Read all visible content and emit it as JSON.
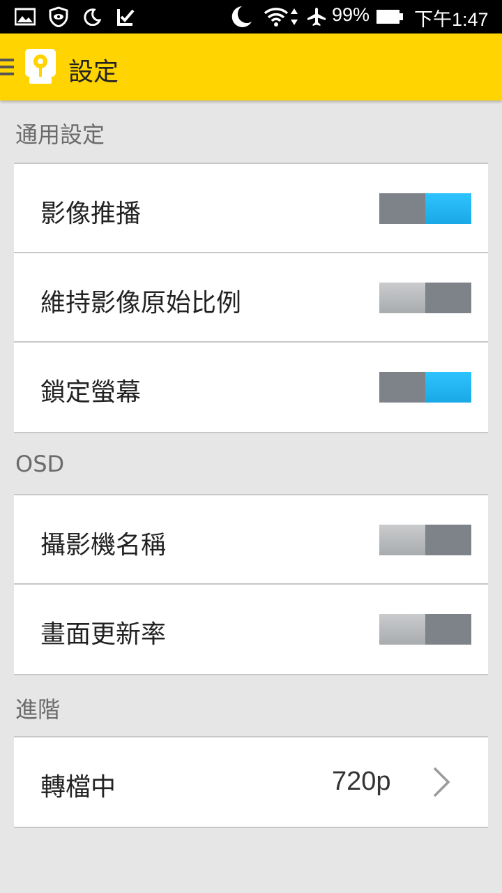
{
  "status_bar": {
    "battery": "99%",
    "time": "下午1:47"
  },
  "app_bar": {
    "title": "設定"
  },
  "sections": [
    {
      "header": "通用設定",
      "items": [
        {
          "label": "影像推播",
          "toggle": true
        },
        {
          "label": "維持影像原始比例",
          "toggle": false
        },
        {
          "label": "鎖定螢幕",
          "toggle": true
        }
      ]
    },
    {
      "header": "OSD",
      "items": [
        {
          "label": "攝影機名稱",
          "toggle": false
        },
        {
          "label": "畫面更新率",
          "toggle": false
        }
      ]
    },
    {
      "header": "進階",
      "items": [
        {
          "label": "轉檔中",
          "value": "720p"
        }
      ]
    }
  ],
  "colors": {
    "app_bar": "#ffd400",
    "toggle_on": "#1fb4f2",
    "toggle_dark": "#7e838a",
    "toggle_off": "#b9bbbd"
  }
}
